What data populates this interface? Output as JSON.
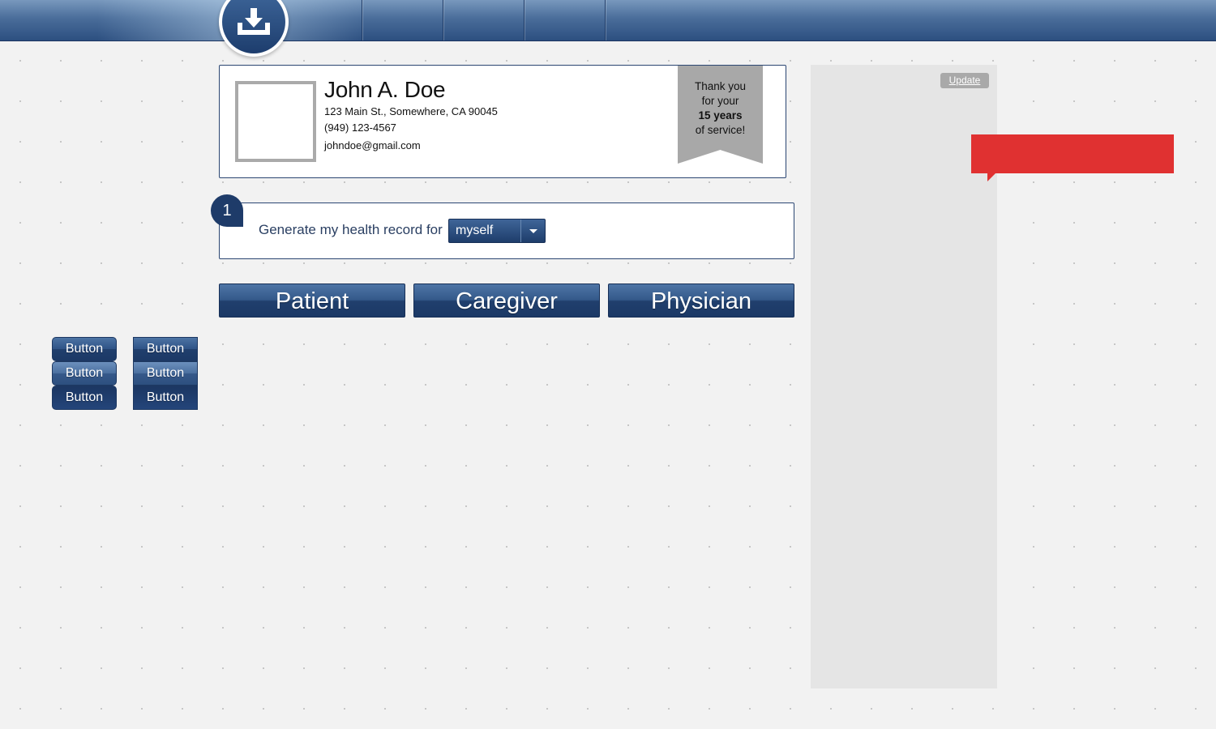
{
  "header": {
    "download_icon": "download-tray-icon"
  },
  "profile": {
    "name": "John A. Doe",
    "address": "123 Main St., Somewhere, CA 90045",
    "phone": "(949) 123-4567",
    "email": "johndoe@gmail.com",
    "ribbon": {
      "line1": "Thank you",
      "line2": "for your",
      "years": "15 years",
      "line4": "of service!"
    }
  },
  "step": {
    "number": "1",
    "label": "Generate my health record for",
    "select_value": "myself"
  },
  "roles": [
    "Patient",
    "Caregiver",
    "Physician"
  ],
  "button_states": {
    "label": "Button"
  },
  "sidebar": {
    "update_label": "Update"
  },
  "colors": {
    "brand_navy": "#1e3b69",
    "alert_red": "#e03131",
    "panel_gray": "#e5e5e5"
  }
}
